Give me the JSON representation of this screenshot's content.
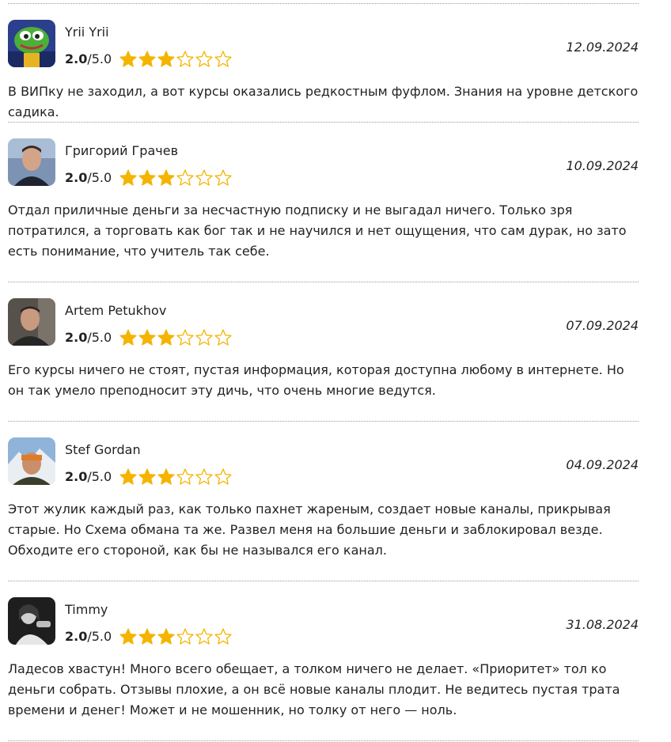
{
  "reviews": [
    {
      "name": "Yrii Yrii",
      "score": "2.0",
      "max": "/5.0",
      "stars_filled": 3,
      "stars_total": 6,
      "date": "12.09.2024",
      "avatar": "frog-cartoon-avatar",
      "text": "В ВИПку не заходил, а вот курсы оказались редкостным фуфлом. Знания на уровне детского садика."
    },
    {
      "name": "Григорий Грачев",
      "score": "2.0",
      "max": "/5.0",
      "stars_filled": 3,
      "stars_total": 6,
      "date": "10.09.2024",
      "avatar": "man-photo-avatar",
      "text": "Отдал приличные деньги за несчастную подписку и не выгадал ничего. Только зря потратился, а торговать как бог так и не научился и нет ощущения, что сам дурак, но зато есть понимание, что учитель так себе."
    },
    {
      "name": "Artem Petukhov",
      "score": "2.0",
      "max": "/5.0",
      "stars_filled": 3,
      "stars_total": 6,
      "date": "07.09.2024",
      "avatar": "man-photo-avatar",
      "text": "Его курсы ничего не стоят, пустая информация, которая доступна любому в интернете. Но он так умело преподносит эту дичь, что очень многие ведутся."
    },
    {
      "name": "Stef Gordan",
      "score": "2.0",
      "max": "/5.0",
      "stars_filled": 3,
      "stars_total": 6,
      "date": "04.09.2024",
      "avatar": "man-mountain-photo-avatar",
      "text": "Этот жулик каждый раз, как только пахнет жареным, создает новые каналы, прикрывая старые. Но Схема обмана та же. Развел меня на большие деньги и заблокировал везде. Обходите его стороной, как бы не назывался его канал."
    },
    {
      "name": "Timmy",
      "score": "2.0",
      "max": "/5.0",
      "stars_filled": 3,
      "stars_total": 6,
      "date": "31.08.2024",
      "avatar": "person-bw-photo-avatar",
      "text": "Ладесов хвастун! Много всего обещает, а толком ничего не делает. «Приоритет» тол ко деньги собрать. Отзывы плохие, а он всё новые каналы плодит. Не ведитесь пустая трата времени и денег! Может и не мошенник, но толку от него — ноль."
    }
  ],
  "colors": {
    "star": "#f4b400",
    "text": "#222222",
    "divider": "#9a9a9a"
  }
}
